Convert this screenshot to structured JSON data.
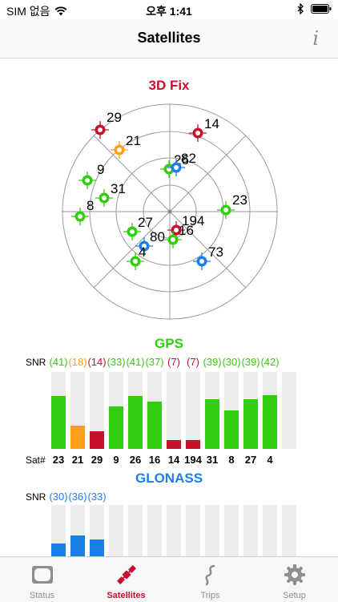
{
  "status_bar": {
    "carrier": "SIM 없음",
    "time": "오후 1:41"
  },
  "nav": {
    "title": "Satellites",
    "info_label": "i"
  },
  "fix": {
    "title": "3D Fix"
  },
  "colors": {
    "green": "#33cc11",
    "orange": "#ff9f1a",
    "red": "#c8102e",
    "blue": "#1a7fe6"
  },
  "skyplot": {
    "satellites": [
      {
        "id": "29",
        "color": "red"
      },
      {
        "id": "21",
        "color": "orange"
      },
      {
        "id": "14",
        "color": "red"
      },
      {
        "id": "26",
        "color": "green"
      },
      {
        "id": "82",
        "color": "blue"
      },
      {
        "id": "9",
        "color": "green"
      },
      {
        "id": "31",
        "color": "green"
      },
      {
        "id": "8",
        "color": "green"
      },
      {
        "id": "23",
        "color": "green"
      },
      {
        "id": "27",
        "color": "green"
      },
      {
        "id": "194",
        "color": "red"
      },
      {
        "id": "16",
        "color": "green"
      },
      {
        "id": "80",
        "color": "blue"
      },
      {
        "id": "4",
        "color": "green"
      },
      {
        "id": "73",
        "color": "blue"
      }
    ]
  },
  "gps": {
    "title": "GPS",
    "snr_label": "SNR",
    "sat_label": "Sat#",
    "sats": [
      {
        "snr": "(41)",
        "sat": "23",
        "value": 41,
        "color": "green"
      },
      {
        "snr": "(18)",
        "sat": "21",
        "value": 18,
        "color": "orange"
      },
      {
        "snr": "(14)",
        "sat": "29",
        "value": 14,
        "color": "red"
      },
      {
        "snr": "(33)",
        "sat": "9",
        "value": 33,
        "color": "green"
      },
      {
        "snr": "(41)",
        "sat": "26",
        "value": 41,
        "color": "green"
      },
      {
        "snr": "(37)",
        "sat": "16",
        "value": 37,
        "color": "green"
      },
      {
        "snr": "(7)",
        "sat": "14",
        "value": 7,
        "color": "red"
      },
      {
        "snr": "(7)",
        "sat": "194",
        "value": 7,
        "color": "red"
      },
      {
        "snr": "(39)",
        "sat": "31",
        "value": 39,
        "color": "green"
      },
      {
        "snr": "(30)",
        "sat": "8",
        "value": 30,
        "color": "green"
      },
      {
        "snr": "(39)",
        "sat": "27",
        "value": 39,
        "color": "green"
      },
      {
        "snr": "(42)",
        "sat": "4",
        "value": 42,
        "color": "green"
      }
    ],
    "max": 60,
    "slots": 13
  },
  "glonass": {
    "title": "GLONASS",
    "snr_label": "SNR",
    "sats": [
      {
        "snr": "(30)",
        "value": 30,
        "color": "blue"
      },
      {
        "snr": "(36)",
        "value": 36,
        "color": "blue"
      },
      {
        "snr": "(33)",
        "value": 33,
        "color": "blue"
      }
    ],
    "max": 60,
    "slots": 13
  },
  "tabs": [
    {
      "label": "Status",
      "icon": "status-icon",
      "active": false
    },
    {
      "label": "Satellites",
      "icon": "satellite-icon",
      "active": true
    },
    {
      "label": "Trips",
      "icon": "trips-icon",
      "active": false
    },
    {
      "label": "Setup",
      "icon": "gear-icon",
      "active": false
    }
  ]
}
